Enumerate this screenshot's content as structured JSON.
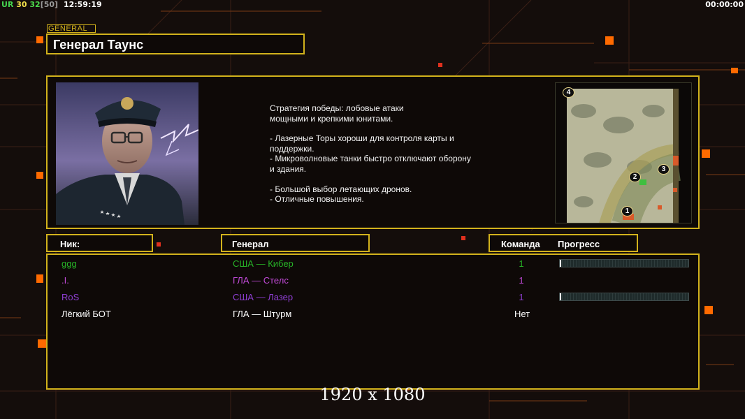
{
  "hud": {
    "ur_label": "UR",
    "num_a": "30",
    "num_b": "32",
    "bracket": "[50]",
    "clock": "12:59:19",
    "timer": "00:00:00"
  },
  "general": {
    "tag": "GENERAL",
    "name": "Генерал Таунс",
    "description": [
      "Стратегия победы: лобовые атаки\nмощными и крепкими юнитами.",
      "- Лазерные Торы хороши для контроля карты и\n поддержки.\n- Микроволновые танки быстро отключают оборону\n и здания.",
      "- Большой выбор летающих дронов.\n- Отличные повышения."
    ]
  },
  "map": {
    "slots": [
      "4",
      "3",
      "2",
      "1"
    ]
  },
  "table": {
    "headers": {
      "nick": "Ник:",
      "general": "Генерал",
      "team": "Команда",
      "progress": "Прогресс"
    },
    "rows": [
      {
        "nick": "ggg",
        "general": "США — Кибер",
        "team": "1",
        "color": "#27b227",
        "progress": 0.01,
        "show_progress": true
      },
      {
        "nick": ".I.",
        "general": "ГЛА — Стелс",
        "team": "1",
        "color": "#c24ad8",
        "progress": 0.0,
        "show_progress": false
      },
      {
        "nick": "RoS",
        "general": "США — Лазер",
        "team": "1",
        "color": "#8f3fd4",
        "progress": 0.01,
        "show_progress": true
      },
      {
        "nick": "Лёгкий БОТ",
        "general": "ГЛА — Штурм",
        "team": "Нет",
        "color": "#ffffff",
        "progress": 0.0,
        "show_progress": false
      }
    ]
  },
  "resolution": "1920 x 1080",
  "colors": {
    "accent": "#d2b21c",
    "orange": "#ff6a00",
    "red": "#e0301e"
  }
}
